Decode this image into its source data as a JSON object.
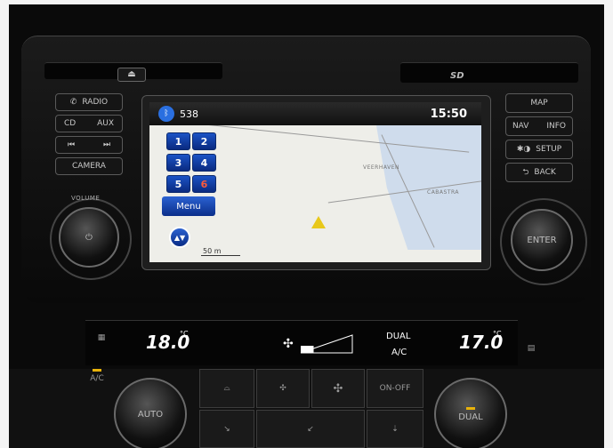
{
  "screen": {
    "status": {
      "bt_icon": "bluetooth-icon",
      "station": "538",
      "clock": "15:50"
    },
    "presets": [
      "1",
      "2",
      "3",
      "4",
      "5",
      "6"
    ],
    "active_preset": "6",
    "menu_label": "Menu",
    "map": {
      "label_1": "VEERHAVEN",
      "label_2": "CABASTRA",
      "scale": "50 m"
    }
  },
  "left_buttons": {
    "radio": "RADIO",
    "cd": "CD",
    "aux": "AUX",
    "prev": "⏮",
    "next": "⏭",
    "camera": "CAMERA",
    "volume": "VOLUME"
  },
  "right_buttons": {
    "map": "MAP",
    "nav": "NAV",
    "info": "INFO",
    "setup": "SETUP",
    "back": "BACK",
    "enter": "ENTER"
  },
  "climate": {
    "left_temp": "18.0",
    "right_temp": "17.0",
    "unit": "°C",
    "dual": "DUAL",
    "ac": "A/C",
    "fan_level": 0.25,
    "ac_button": "A/C",
    "auto": "AUTO",
    "dual_button": "DUAL",
    "on_off": "ON-OFF"
  },
  "colors": {
    "preset_blue": "#1c53c6",
    "lamp": "#e8b20a",
    "active_preset_text": "#ff5a3a"
  }
}
